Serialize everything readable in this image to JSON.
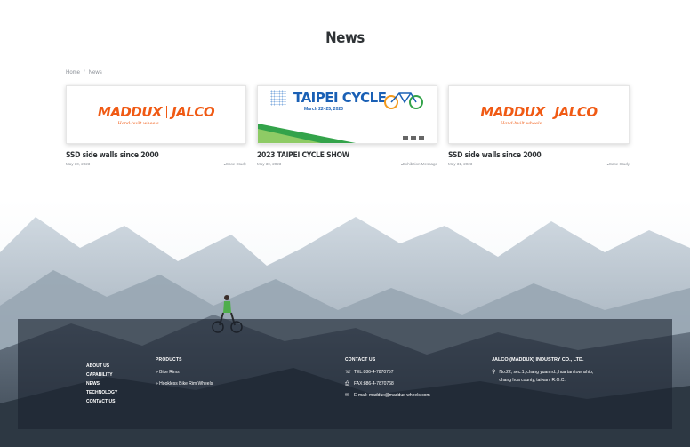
{
  "page": {
    "title": "News"
  },
  "breadcrumb": {
    "home": "Home",
    "separator": "/",
    "current": "News"
  },
  "articles": [
    {
      "title": "SSD side walls since 2000",
      "date": "May 30, 2023",
      "category": "Case Study",
      "logo": {
        "brand_left": "MADDUX",
        "brand_right": "JALCO",
        "tagline": "Hand-built wheels"
      }
    },
    {
      "title": "2023 TAIPEI CYCLE SHOW",
      "date": "May 30, 2023",
      "category": "Exhibition Message",
      "banner": {
        "title": "TAIPEI CYCLE",
        "dates": "March 22–25, 2023"
      }
    },
    {
      "title": "SSD side walls since 2000",
      "date": "May 31, 2023",
      "category": "Case Study",
      "logo": {
        "brand_left": "MADDUX",
        "brand_right": "JALCO",
        "tagline": "Hand-built wheels"
      }
    }
  ],
  "footer": {
    "nav": [
      "ABOUT US",
      "CAPABILITY",
      "NEWS",
      "TECHNOLOGY",
      "CONTACT US"
    ],
    "products": {
      "heading": "PRODUCTS",
      "items": [
        "Bike Rims",
        "Hookless Bike Rim Wheels"
      ]
    },
    "contact": {
      "heading": "CONTACT US",
      "tel": "TEL:886-4-7870757",
      "fax": "FAX:886-4-7870768",
      "email": "E-mail: maddux@maddux-wheels.com"
    },
    "company": {
      "name": "JALCO (MADDUX) INDUSTRY CO., LTD.",
      "address_line1": "No.22, sec.1, chang yuan rd., hua tan township,",
      "address_line2": "chang hua county, taiwan, R.O.C."
    }
  },
  "colors": {
    "brand_orange": "#f05a14",
    "taipei_blue": "#1a60b5",
    "footer_overlay": "rgba(28,36,48,0.62)"
  },
  "icons": {
    "phone": "phone-icon",
    "fax": "fax-icon",
    "email": "mail-icon",
    "address": "map-marker-icon",
    "category": "folder-icon"
  }
}
